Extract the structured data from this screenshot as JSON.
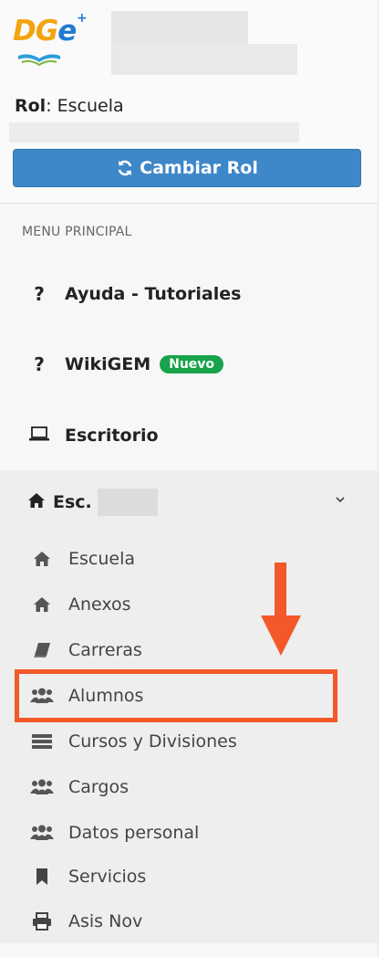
{
  "header": {
    "logo_text": {
      "d": "DG",
      "e": "e",
      "sup": "+"
    },
    "role_key": "Rol",
    "role_value": ": Escuela",
    "change_role_label": "Cambiar Rol"
  },
  "menu": {
    "section_label": "MENU PRINCIPAL",
    "items": [
      {
        "label": "Ayuda - Tutoriales",
        "icon": "question-icon"
      },
      {
        "label": "WikiGEM",
        "icon": "question-icon",
        "badge": "Nuevo"
      },
      {
        "label": "Escritorio",
        "icon": "laptop-icon"
      }
    ],
    "group": {
      "label": "Esc.",
      "expanded": true,
      "subitems": [
        {
          "label": "Escuela",
          "icon": "home-icon"
        },
        {
          "label": "Anexos",
          "icon": "home-icon"
        },
        {
          "label": "Carreras",
          "icon": "book-icon"
        },
        {
          "label": "Alumnos",
          "icon": "users-icon",
          "highlighted": true
        },
        {
          "label": "Cursos y Divisiones",
          "icon": "stack-icon"
        },
        {
          "label": "Cargos",
          "icon": "users-icon"
        },
        {
          "label": "Datos personal",
          "icon": "users-icon"
        },
        {
          "label": "Servicios",
          "icon": "bookmark-icon"
        },
        {
          "label": "Asis Nov",
          "icon": "printer-icon"
        }
      ]
    }
  },
  "colors": {
    "accent": "#3e87c8",
    "badge": "#17a34a",
    "annotation": "#f2582a"
  }
}
